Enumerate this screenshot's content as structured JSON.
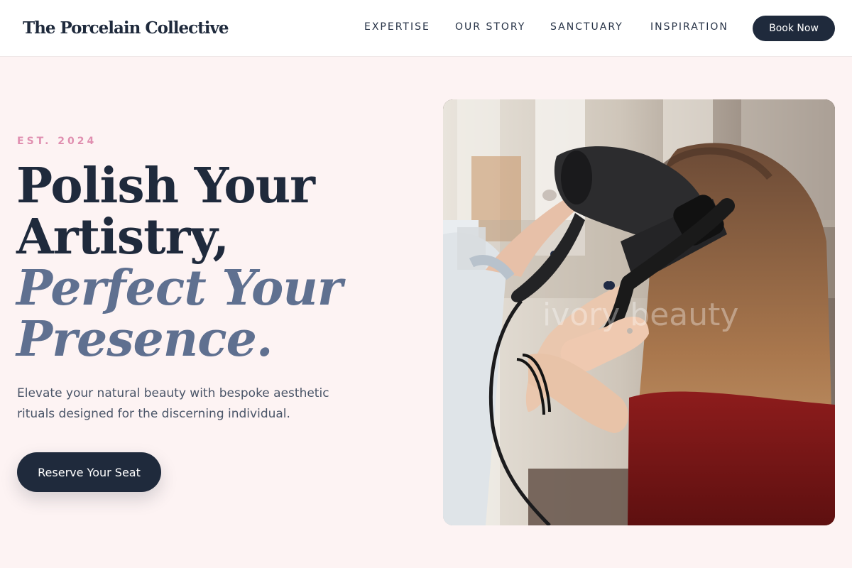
{
  "header": {
    "logo": "The Porcelain Collective",
    "nav": [
      "EXPERTISE",
      "OUR STORY",
      "SANCTUARY",
      "INSPIRATION"
    ],
    "book_label": "Book Now"
  },
  "hero": {
    "eyebrow": "EST. 2024",
    "headline_line1": "Polish Your",
    "headline_line2": "Artistry,",
    "headline_line3": "Perfect Your",
    "headline_line4": "Presence.",
    "subtext": "Elevate your natural beauty with bespoke aesthetic rituals designed for the discerning individual.",
    "cta_label": "Reserve Your Seat",
    "image_watermark": "ivory beauty"
  },
  "colors": {
    "navy": "#1f2a3c",
    "accent_pink": "#e08fb0",
    "slate_italic": "#5f7090",
    "background": "#fdf3f3"
  }
}
